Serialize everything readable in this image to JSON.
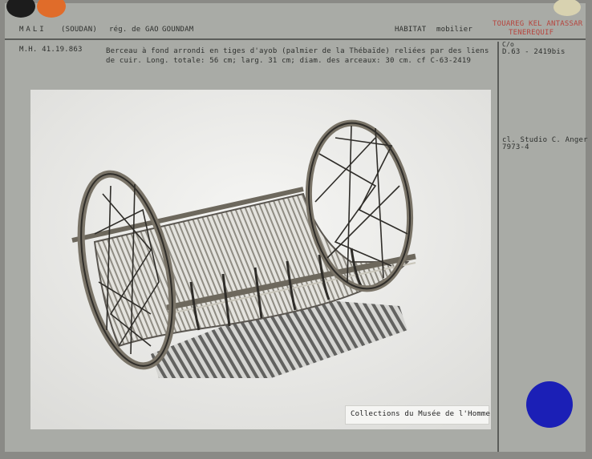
{
  "header": {
    "country": "MALI",
    "country_alt": "(SOUDAN)",
    "region": "rég. de GAO",
    "locality": "GOUNDAM",
    "category": "HABITAT",
    "subcategory": "mobilier",
    "ethnic_line1": "TOUAREG KEL ANTASSAR",
    "ethnic_line2": "TENEREQUIF"
  },
  "record": {
    "inventory": "M.H. 41.19.863",
    "description_line1": "Berceau à fond arrondi en tiges d'ayob (palmier de la Thébaïde) reliées par des liens",
    "description_line2": "de cuir. Long. totale: 56 cm; larg. 31 cm; diam. des arceaux: 30 cm.   cf C-63-2419"
  },
  "side": {
    "photo_ref_top": "C/o",
    "photo_ref": "D.63 - 2419bis",
    "credit_line1": "cl. Studio C. Anger",
    "credit_line2": "7973-4"
  },
  "photo": {
    "caption": "Collections du Musée de l'Homme"
  },
  "colors": {
    "card": "#a9aba6",
    "text": "#2e302e",
    "ethnic_text": "#b6453e",
    "blue_sticker": "#1b1fb6",
    "orange_sticker": "#e06c2a",
    "black_sticker": "#1c1c1c",
    "gold_sticker": "#d8d2b0"
  }
}
